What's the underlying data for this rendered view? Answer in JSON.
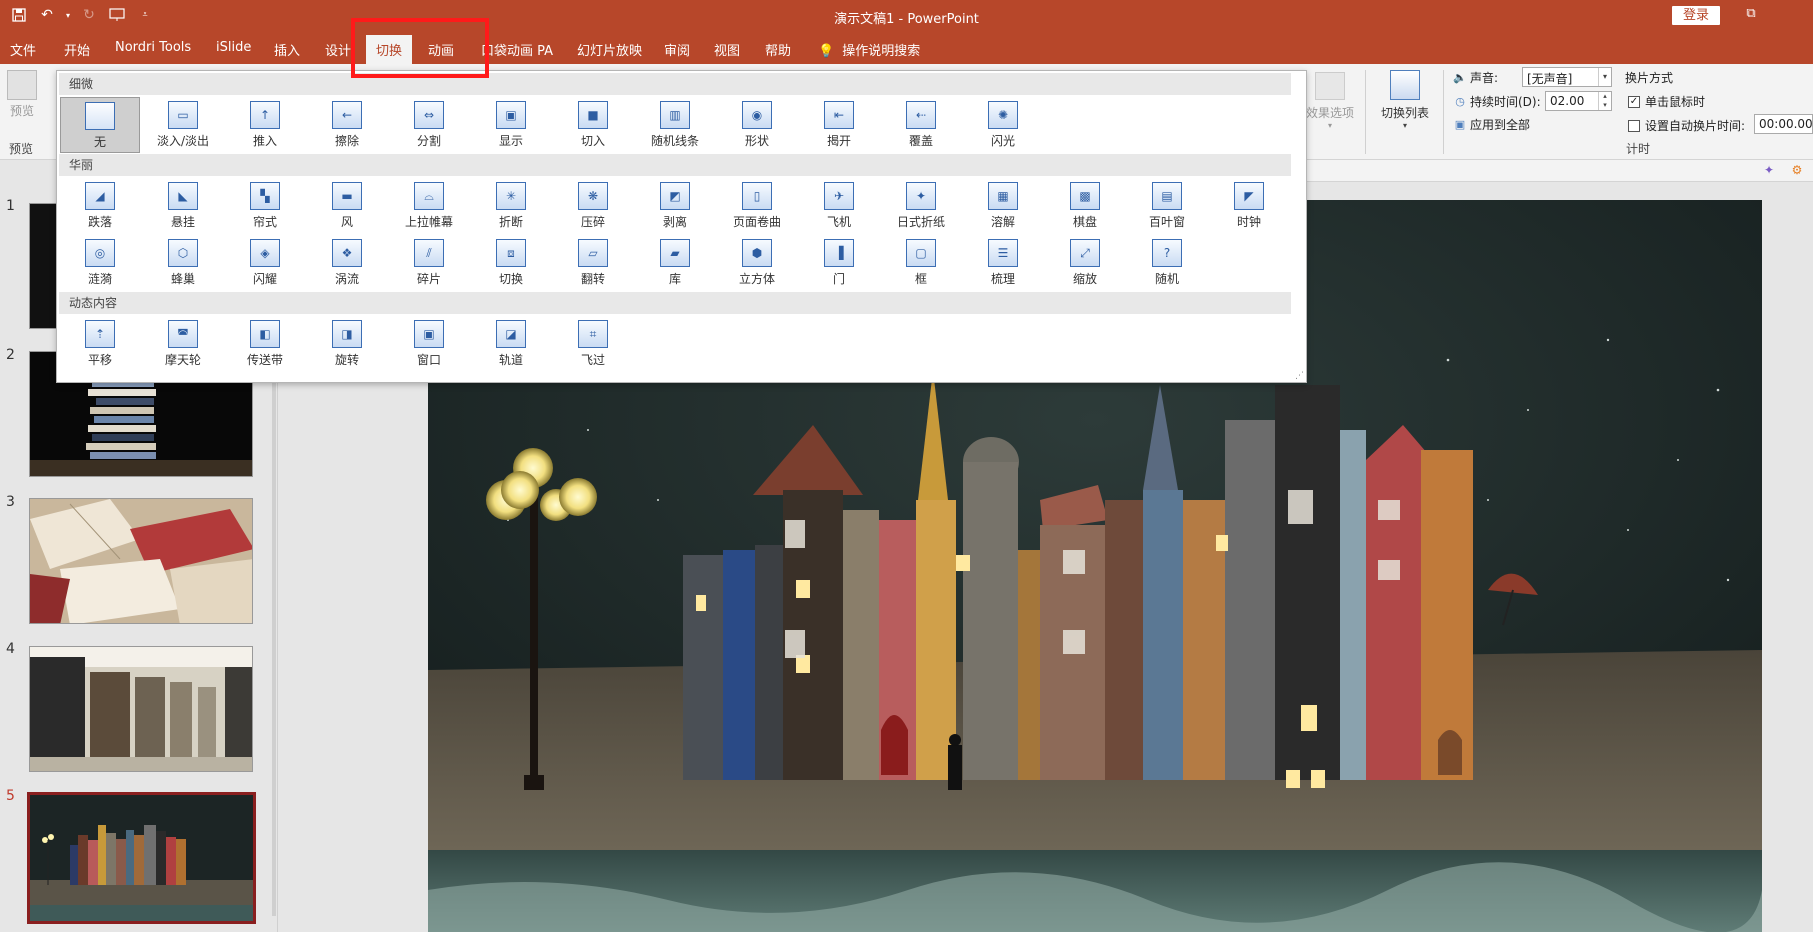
{
  "titlebar": {
    "title": "演示文稿1  -  PowerPoint",
    "login": "登录"
  },
  "tabs": [
    {
      "label": "文件"
    },
    {
      "label": "开始"
    },
    {
      "label": "Nordri Tools"
    },
    {
      "label": "iSlide"
    },
    {
      "label": "插入"
    },
    {
      "label": "设计"
    },
    {
      "label": "切换"
    },
    {
      "label": "动画"
    },
    {
      "label": "口袋动画 PA"
    },
    {
      "label": "幻灯片放映"
    },
    {
      "label": "审阅"
    },
    {
      "label": "视图"
    },
    {
      "label": "帮助"
    },
    {
      "label": "操作说明搜索"
    }
  ],
  "ribbon": {
    "preview": "预览",
    "preview_group": "预览",
    "effect_options": "效果选项",
    "switch_list": "切换列表",
    "sound_label": "声音:",
    "sound_value": "[无声音]",
    "duration_label": "持续时间(D):",
    "duration_value": "02.00",
    "apply_all": "应用到全部",
    "advance_title": "换片方式",
    "on_click": "单击鼠标时",
    "auto_after": "设置自动换片时间:",
    "auto_value": "00:00.00",
    "timing_group": "计时"
  },
  "gallery": {
    "categories": [
      {
        "name": "细微",
        "items": [
          "无",
          "淡入/淡出",
          "推入",
          "擦除",
          "分割",
          "显示",
          "切入",
          "随机线条",
          "形状",
          "揭开",
          "覆盖",
          "闪光"
        ]
      },
      {
        "name": "华丽",
        "items": [
          "跌落",
          "悬挂",
          "帘式",
          "风",
          "上拉帷幕",
          "折断",
          "压碎",
          "剥离",
          "页面卷曲",
          "飞机",
          "日式折纸",
          "溶解",
          "棋盘",
          "百叶窗",
          "时钟",
          "涟漪",
          "蜂巢",
          "闪耀",
          "涡流",
          "碎片",
          "切换",
          "翻转",
          "库",
          "立方体",
          "门",
          "框",
          "梳理",
          "缩放",
          "随机"
        ]
      },
      {
        "name": "动态内容",
        "items": [
          "平移",
          "摩天轮",
          "传送带",
          "旋转",
          "窗口",
          "轨道",
          "飞过"
        ]
      }
    ],
    "selected": "无"
  },
  "slides": [
    {
      "number": "1"
    },
    {
      "number": "2"
    },
    {
      "number": "3"
    },
    {
      "number": "4"
    },
    {
      "number": "5"
    }
  ],
  "active_slide": "5",
  "colors": {
    "accent": "#b7472a",
    "highlight": "#ff1a1a"
  }
}
